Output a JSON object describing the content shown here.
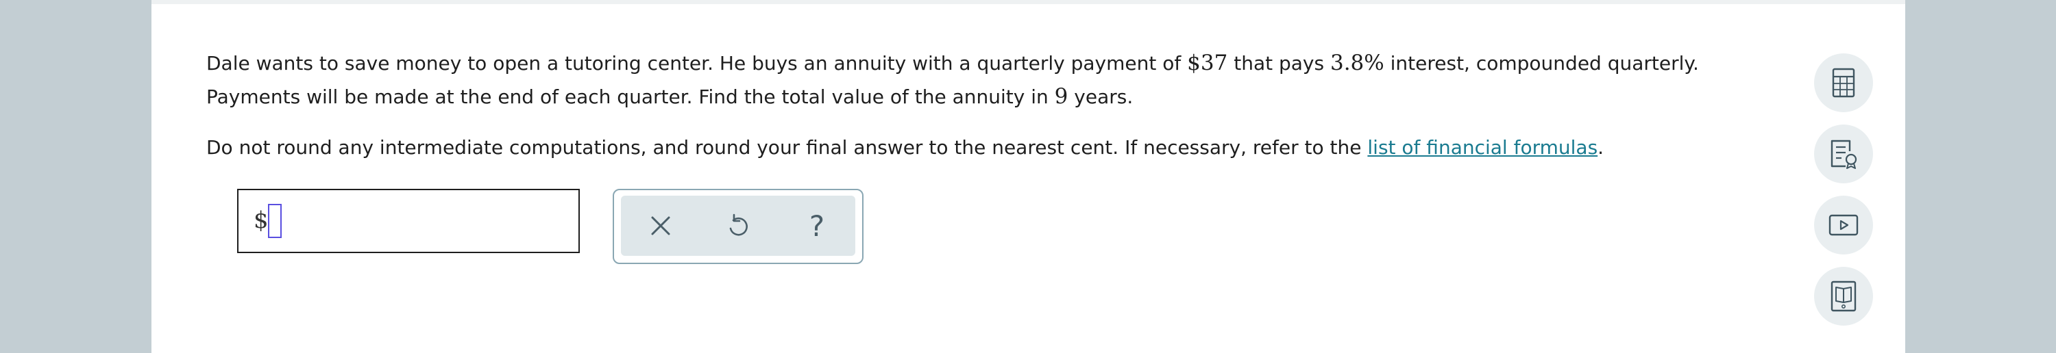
{
  "question": {
    "line1_a": "Dale wants to save money to open a tutoring center. He buys an annuity with a quarterly payment of ",
    "payment": "$37",
    "line1_b": " that pays ",
    "rate": "3.8%",
    "line1_c": " interest, compounded quarterly.",
    "line2_a": "Payments will be made at the end of each quarter. Find the total value of the annuity in ",
    "years": "9",
    "line2_b": " years.",
    "instr_a": "Do not round any intermediate computations, and round your final answer to the nearest cent. If necessary, refer to the ",
    "link_text": "list of financial formulas",
    "instr_b": "."
  },
  "answer": {
    "currency_symbol": "$",
    "value": ""
  },
  "toolbar": {
    "clear_icon": "x-icon",
    "undo_icon": "undo-icon",
    "help_label": "?"
  },
  "sidebar": {
    "buttons": [
      "calculator-icon",
      "formula-sheet-icon",
      "video-icon",
      "ebook-icon"
    ]
  },
  "colors": {
    "background": "#c3ced3",
    "link": "#1a7b90",
    "toolbar_border": "#8aa7b3",
    "caret_border": "#5a4fe0"
  }
}
